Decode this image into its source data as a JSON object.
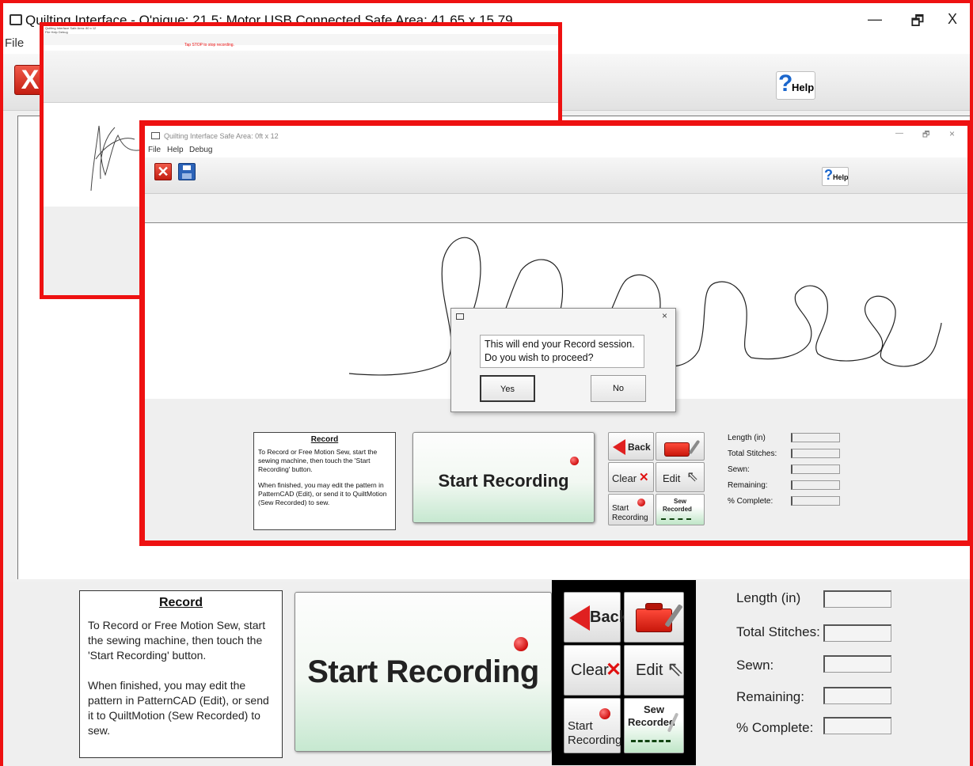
{
  "main_window": {
    "title": "Quilting Interface - Q'nique: 21        5: Motor USB Connected        Safe Area: 41.65 x 15.79",
    "controls": {
      "minimize": "—",
      "restore": "🗗",
      "close": "X"
    },
    "menu": [
      "File"
    ],
    "toolbar": {
      "close_icon": "X",
      "help_label": "Help",
      "help_glyph": "?"
    },
    "info": {
      "title": "Record",
      "p1": "To Record or Free Motion Sew, start the sewing machine, then touch the 'Start Recording' button.",
      "p2": "When finished, you may edit the pattern in PatternCAD (Edit), or send it to QuiltMotion (Sew Recorded) to sew."
    },
    "start_recording_label": "Start Recording",
    "buttons": {
      "back": "Back",
      "clear": "Clear",
      "edit": "Edit",
      "start_line1": "Start",
      "start_line2": "Recording",
      "sew_line1": "Sew",
      "sew_line2": "Recorded"
    },
    "stats": [
      "Length (in)",
      "Total Stitches:",
      "Sewn:",
      "Remaining:",
      "% Complete:"
    ]
  },
  "overlay_stop": {
    "title": "Quilting Interface   Safe Area: 80 x 12",
    "menu": "File   Help   Debug",
    "stop_text": "Tap STOP to stop recording."
  },
  "overlay_record": {
    "title": "Quilting Interface       Safe Area: 0ft x 12",
    "menu": [
      "File",
      "Help",
      "Debug"
    ],
    "controls": {
      "minimize": "—",
      "restore": "🗗",
      "close": "×"
    },
    "help_label": "Help",
    "help_glyph": "?",
    "dialog": {
      "message_line1": "This will end your Record session.",
      "message_line2": "Do you wish to proceed?",
      "yes": "Yes",
      "no": "No",
      "close": "×"
    }
  },
  "colors": {
    "highlight_frame": "#e11111",
    "button_grid_frame": "#000000",
    "start_button_gradient_bottom": "#c6e8d0",
    "help_question_mark": "#1a66cc"
  },
  "icons": [
    "close-icon",
    "save-icon",
    "help-icon",
    "back-arrow-icon",
    "toolbox-icon",
    "red-x-icon",
    "cursor-icon",
    "record-dot-icon",
    "sew-recorded-icon"
  ]
}
